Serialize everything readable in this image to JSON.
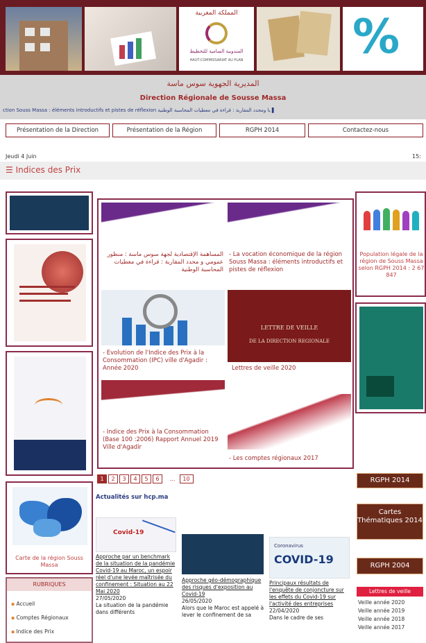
{
  "header": {
    "arabic_title": "المديرية الجهوية سوس ماسة",
    "french_title": "Direction Régionale de Sousse Massa",
    "ticker": "ction Souss Massa : éléments introductifs et pistes de réflexion  يا ومحدد المقاربة : قراءة في معطيات المحاسبة الوطنية  ▌"
  },
  "nav": [
    "Présentation de la Direction",
    "Présentation de la Région",
    "RGPH 2014",
    "Contactez-nous"
  ],
  "date": "Jeudi 4 Juin",
  "clock": "15:",
  "page_title": "Indices des Prix",
  "tiles": [
    {
      "caption": "المساهمة الإقتصادية لجهة سوس ماسة : منظور عمومي و محدد المقاربة : قراءة في معطيات المحاسبة الوطنية"
    },
    {
      "caption": "- La vocation économique de la région Souss Massa : éléments introductifs et pistes de réflexion"
    },
    {
      "caption": "- Evolution de l'Indice des Prix à la Consommation (IPC) ville d'Agadir : Année 2020"
    },
    {
      "caption": "Lettres de veille 2020",
      "img_line1": "LETTRE DE VEILLE",
      "img_line2": "DE LA DIRECTION REGIONALE"
    },
    {
      "caption": "- Indice des Prix à la Consommation (Base 100 :2006) Rapport Annuel 2019 Ville d'Agadir"
    },
    {
      "caption": "- Les comptes régionaux 2017"
    }
  ],
  "pager": {
    "pages": [
      "1",
      "2",
      "3",
      "4",
      "5",
      "6"
    ],
    "ellipsis": "...",
    "last": "10"
  },
  "left_col": {
    "map_caption": "Carte de la région Souss Massa",
    "rubriques_title": "RUBRIQUES",
    "rubriques": [
      "Accueil",
      "Comptes Régionaux",
      "Indice des Prix"
    ]
  },
  "right_col": {
    "pop_caption": "Population légale de la région de Souss Massa selon RGPH 2014 : 2 67 847",
    "btn1": "RGPH 2014",
    "btn2": "Cartes Thématiques 2014",
    "btn3": "RGPH 2004",
    "veille_title": "Lettres de veille",
    "veille": [
      "Veille année 2020",
      "Veille année 2019",
      "Veille année 2018",
      "Veille année 2017"
    ]
  },
  "actualites": {
    "title": "Actualités sur hcp.ma",
    "items": [
      {
        "img_text": "Covid-19",
        "title": "Approche par un benchmark de la situation de la pandémie Covid-19 au Maroc, un espoir réel d'une levée maîtrisée du confinement : Situation au 22 Mai 2020",
        "date": "27/05/2020",
        "excerpt": "La situation de la pandémie dans différents"
      },
      {
        "title": "Approche géo-démographique des risques d'exposition au Covid-19",
        "date": "26/05/2020",
        "excerpt": "Alors que le Maroc est appelé à lever le confinement de sa"
      },
      {
        "img_text": "COVID-19",
        "img_sub": "Coronavirus",
        "title": "Principaux résultats de l'enquête de conjoncture sur les effets du Covid-19 sur l'activité des entreprises",
        "date": "22/04/2020",
        "excerpt": "Dans le cadre de ses"
      }
    ]
  }
}
